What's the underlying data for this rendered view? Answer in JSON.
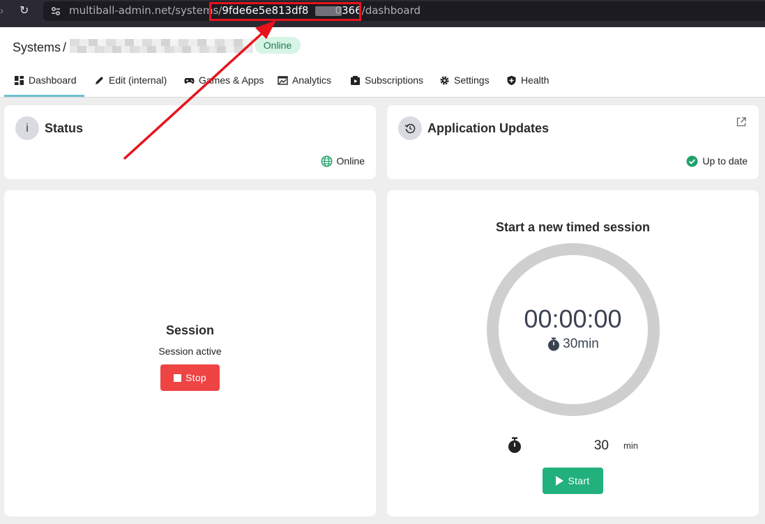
{
  "browser": {
    "url_prefix": "multiball-admin.net/systems/",
    "url_id_start": "9fde6e5e813df8",
    "url_id_end": "0366",
    "url_suffix": "/dashboard"
  },
  "header": {
    "breadcrumb_root": "Systems",
    "breadcrumb_separator": "/",
    "status_badge": "Online"
  },
  "tabs": [
    {
      "label": "Dashboard",
      "icon": "dashboard-grid-icon",
      "active": true
    },
    {
      "label": "Edit (internal)",
      "icon": "pencil-icon"
    },
    {
      "label": "Games & Apps",
      "icon": "gamepad-icon"
    },
    {
      "label": "Analytics",
      "icon": "chart-line-icon"
    },
    {
      "label": "Subscriptions",
      "icon": "video-icon"
    },
    {
      "label": "Settings",
      "icon": "gear-icon"
    },
    {
      "label": "Health",
      "icon": "shield-icon"
    }
  ],
  "status_card": {
    "icon_glyph": "i",
    "title": "Status",
    "value": "Online"
  },
  "updates_card": {
    "title": "Application Updates",
    "value": "Up to date"
  },
  "session_card": {
    "title": "Session",
    "subtitle": "Session active",
    "stop_label": "Stop"
  },
  "timer_card": {
    "title": "Start a new timed session",
    "time_display": "00:00:00",
    "duration_display": "30min",
    "duration_value": "30",
    "duration_unit": "min",
    "start_label": "Start"
  },
  "colors": {
    "accent_tab": "#6ec1d0",
    "online_green": "#1e7a4e",
    "stop_red": "#ef4444",
    "start_green": "#22b07d",
    "annotation_red": "#e8121c"
  }
}
